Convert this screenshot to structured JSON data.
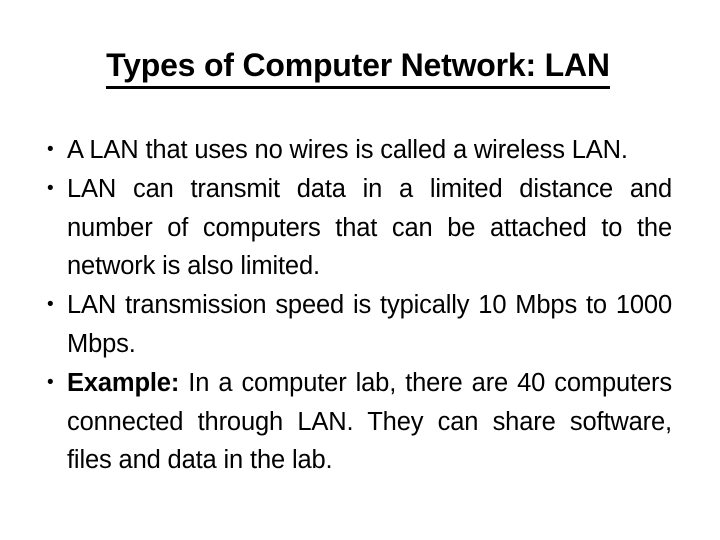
{
  "slide": {
    "title": "Types of Computer Network: LAN",
    "title_underlined": true,
    "background_color": "#ffffff",
    "text_color": "#000000",
    "bullets": [
      {
        "id": "bullet-wireless-lan",
        "text": "A LAN that uses no wires is called a wireless LAN.",
        "bold_lead": "",
        "bold": false
      },
      {
        "id": "bullet-limited-distance",
        "text": "LAN can transmit data in a limited distance and number of computers that can be attached to the network is also limited.",
        "bold_lead": "",
        "bold": false
      },
      {
        "id": "bullet-transmission-speed",
        "text": "LAN transmission speed is typically 10 Mbps to 1000 Mbps.",
        "bold_lead": "",
        "bold": false
      },
      {
        "id": "bullet-example",
        "text": "In a computer lab, there are 40 computers connected through LAN. They can share software, files and data in the lab.",
        "bold_lead": "Example:",
        "bold": false
      }
    ],
    "bullet_glyph": "•"
  }
}
